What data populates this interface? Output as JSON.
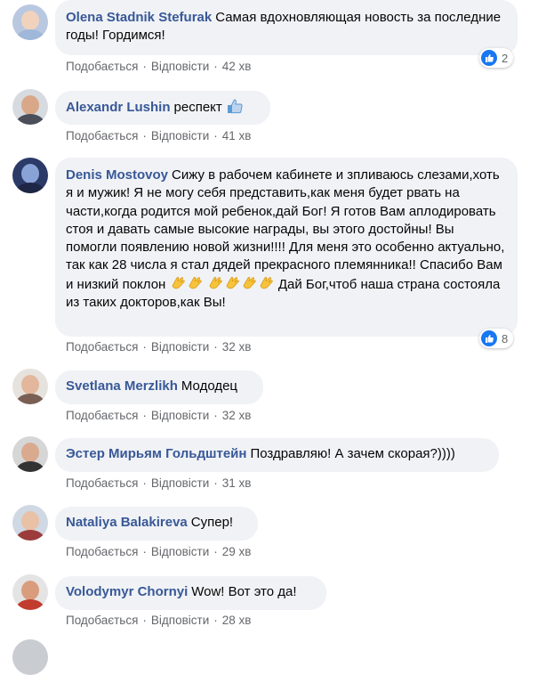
{
  "actions": {
    "like": "Подобається",
    "reply": "Відповісти",
    "separator": "·"
  },
  "comments": [
    {
      "author": "Olena Stadnik Stefurak",
      "text": "Самая вдохновляющая новость за последние годы! Гордимся!",
      "time": "42 хв",
      "reactions": "2"
    },
    {
      "author": "Alexandr Lushin",
      "text": "респект",
      "time": "41 хв"
    },
    {
      "author": "Denis Mostovoy",
      "text_1": "Сижу в рабочем кабинете и зпливаюсь слезами,хоть я и мужик! Я не могу себя представить,как меня будет рвать на части,когда родится мой ребенок,дай Бог! Я готов Вам аплодировать стоя и давать самые высокие награды, вы этого достойны! Вы помогли появлению новой жизни!!!! Для меня это особенно актуально, так как 28 числа я стал дядей прекрасного племянника!! Спасибо Вам и низкий поклон",
      "text_2": " Дай Бог,чтоб наша страна состояла из таких докторов,как Вы!",
      "time": "32 хв",
      "reactions": "8"
    },
    {
      "author": "Svetlana Merzlikh",
      "text": "Мододец",
      "time": "32 хв"
    },
    {
      "author": "Эстер Мирьям Гольдштейн",
      "text": "Поздравляю! А зачем скорая?))))",
      "time": "31 хв"
    },
    {
      "author": "Nataliya Balakireva",
      "text": "Супер!",
      "time": "29 хв"
    },
    {
      "author": "Volodymyr Chornyi",
      "text": "Wow! Вот это да!",
      "time": "28 хв"
    }
  ],
  "colors": {
    "link": "#385898",
    "bubble": "#f0f2f5",
    "meta": "#65676b",
    "like_blue": "#1877f2"
  }
}
